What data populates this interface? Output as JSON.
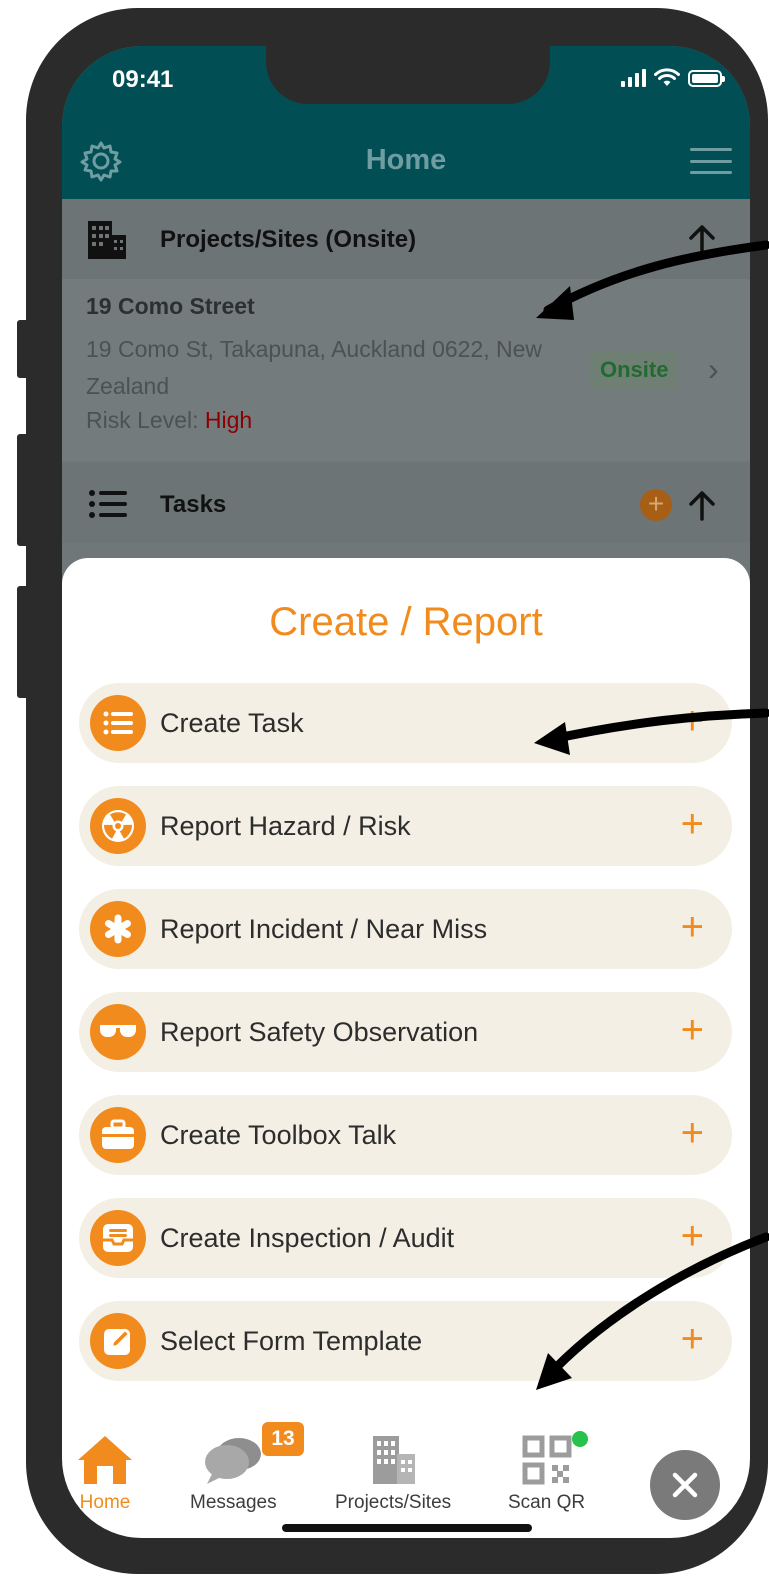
{
  "status_bar": {
    "time": "09:41"
  },
  "header": {
    "title": "Home",
    "settings_icon": "gear-icon",
    "menu_icon": "hamburger-icon"
  },
  "projects": {
    "title": "Projects/Sites (Onsite)",
    "icon": "building-icon",
    "site": {
      "name": "19 Como Street",
      "address": "19 Como St, Takapuna, Auckland 0622, New Zealand",
      "risk_label": "Risk Level:",
      "risk_value": "High",
      "status": "Onsite"
    }
  },
  "tasks": {
    "title": "Tasks",
    "icon": "list-icon"
  },
  "sheet": {
    "title": "Create / Report",
    "actions": [
      {
        "label": "Create Task",
        "icon": "list-icon"
      },
      {
        "label": "Report Hazard / Risk",
        "icon": "radiation-icon"
      },
      {
        "label": "Report Incident / Near Miss",
        "icon": "asterisk-icon"
      },
      {
        "label": "Report Safety Observation",
        "icon": "glasses-icon"
      },
      {
        "label": "Create Toolbox Talk",
        "icon": "toolbox-icon"
      },
      {
        "label": "Create Inspection / Audit",
        "icon": "inbox-icon"
      },
      {
        "label": "Select Form Template",
        "icon": "edit-icon"
      }
    ],
    "plus_symbol": "+"
  },
  "tabbar": {
    "tabs": [
      {
        "label": "Home",
        "icon": "home-icon"
      },
      {
        "label": "Messages",
        "icon": "chat-icon",
        "badge": "13"
      },
      {
        "label": "Projects/Sites",
        "icon": "building-icon"
      },
      {
        "label": "Scan QR",
        "icon": "qr-icon"
      }
    ],
    "close_icon": "close-icon"
  },
  "colors": {
    "accent": "#f28b1d",
    "header": "#014f55",
    "risk_high": "#8c0000",
    "onsite": "#206b2f"
  }
}
